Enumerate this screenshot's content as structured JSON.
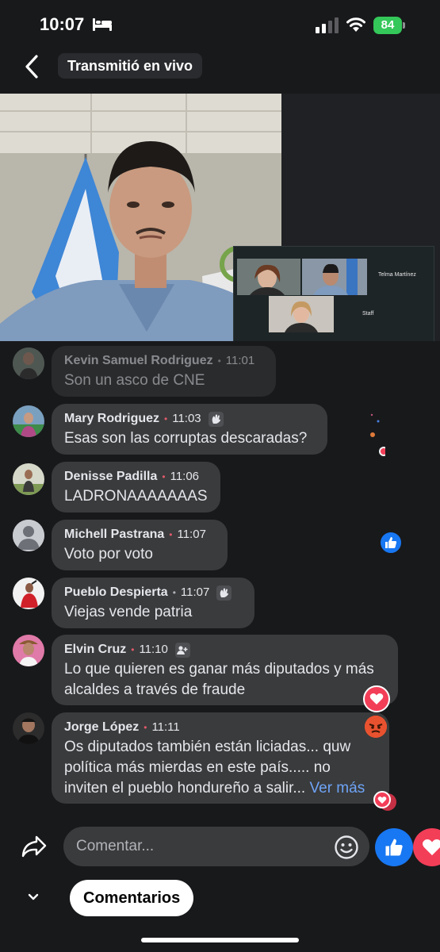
{
  "status": {
    "time": "10:07",
    "battery": "84"
  },
  "header": {
    "title": "Transmitió en vivo"
  },
  "video": {
    "participants": [
      "Telma Martínez",
      "Staff"
    ]
  },
  "comments": [
    {
      "author": "Kevin Samuel Rodriguez",
      "time": "11:01",
      "text": "Son un asco de CNE",
      "dot_color": "#b0b3b8",
      "badge": null,
      "faded": true
    },
    {
      "author": "Mary Rodriguez",
      "time": "11:03",
      "text": "Esas son las corruptas descaradas?",
      "dot_color": "#e05a6b",
      "badge": "wave-icon"
    },
    {
      "author": "Denisse Padilla",
      "time": "11:06",
      "text": "LADRONAAAAAAAS",
      "dot_color": "#e05a6b",
      "badge": null
    },
    {
      "author": "Michell Pastrana",
      "time": "11:07",
      "text": "Voto por voto",
      "dot_color": "#e05a6b",
      "badge": null
    },
    {
      "author": "Pueblo Despierta",
      "time": "11:07",
      "text": "Viejas vende patria",
      "dot_color": "#b0b3b8",
      "badge": "wave-icon"
    },
    {
      "author": "Elvin Cruz",
      "time": "11:10",
      "text_lines": [
        "Lo que quieren es ganar más diputados y más",
        "alcaldes a través de fraude"
      ],
      "dot_color": "#e05a6b",
      "badge": "person-add-icon"
    },
    {
      "author": "Jorge López",
      "time": "11:11",
      "text_lines": [
        "Os diputados también están liciadas... quw",
        "política más mierdas en este país..... no",
        "inviten el pueblo hondureño a salir..."
      ],
      "see_more": "Ver más",
      "dot_color": "#e05a6b",
      "badge": null
    }
  ],
  "composer": {
    "placeholder": "Comentar..."
  },
  "footer": {
    "comments_tab": "Comentarios"
  },
  "colors": {
    "accent_blue": "#1877f2",
    "love_red": "#f33e58",
    "bubble": "#3a3b3c",
    "background": "#18191b"
  }
}
